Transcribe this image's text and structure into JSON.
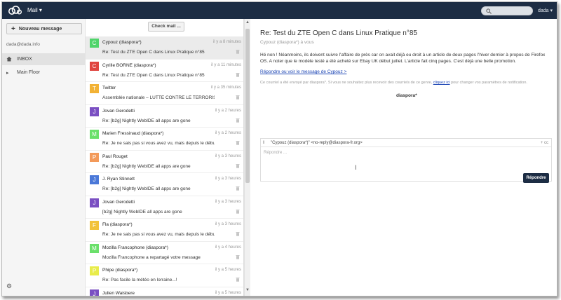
{
  "header": {
    "app_name": "Mail ▾",
    "user": "dada ▾",
    "search_placeholder": ""
  },
  "sidebar": {
    "new_message": "Nouveau message",
    "account": "dada@dada.info",
    "items": [
      {
        "label": "INBOX",
        "icon": "home-icon",
        "active": true
      },
      {
        "label": "Main Floor",
        "icon": "chevron-right-icon",
        "active": false
      }
    ]
  },
  "list": {
    "check_mail": "Check mail ...",
    "messages": [
      {
        "initial": "C",
        "color": "#4fd46a",
        "sender": "Cypouz (diaspora*)",
        "date": "il y a 8 minutes",
        "subject": "Re: Test du ZTE Open C dans Linux Pratique n°85",
        "selected": true
      },
      {
        "initial": "C",
        "color": "#e0443f",
        "sender": "Cyrille BORNE (diaspora*)",
        "date": "il y a 11 minutes",
        "subject": "Re: Test du ZTE Open C dans Linux Pratique n°85"
      },
      {
        "initial": "T",
        "color": "#f2b235",
        "sender": "Twitter",
        "date": "il y a 35 minutes",
        "subject": "Assemblée nationale – LUTTE CONTRE LE TERRORISME(..."
      },
      {
        "initial": "J",
        "color": "#7a4fc2",
        "sender": "Jovan Gerodetti",
        "date": "il y a 2 heures",
        "subject": "Re: [b2g] Nightly WebIDE all apps are gone"
      },
      {
        "initial": "M",
        "color": "#6be06b",
        "sender": "Marien Fressinaud (diaspora*)",
        "date": "il y a 2 heures",
        "subject": "Re: Je ne sais pas si vous avez vu, mais depuis le début d..."
      },
      {
        "initial": "P",
        "color": "#f39a5a",
        "sender": "Paul Rouget",
        "date": "il y a 3 heures",
        "subject": "Re: [b2g] Nightly WebIDE all apps are gone"
      },
      {
        "initial": "J",
        "color": "#4a78d8",
        "sender": "J. Ryan Stinnett",
        "date": "il y a 3 heures",
        "subject": "Re: [b2g] Nightly WebIDE all apps are gone"
      },
      {
        "initial": "J",
        "color": "#7a4fc2",
        "sender": "Jovan Gerodetti",
        "date": "il y a 3 heures",
        "subject": "[b2g] Nightly WebIDE all apps are gone"
      },
      {
        "initial": "F",
        "color": "#f2c23a",
        "sender": "Fla (diaspora*)",
        "date": "il y a 3 heures",
        "subject": "Re: Je ne sais pas si vous avez vu, mais depuis le début d..."
      },
      {
        "initial": "M",
        "color": "#6be06b",
        "sender": "Mozilla Francophone (diaspora*)",
        "date": "il y a 4 heures",
        "subject": "Mozilla Francophone a repartagé votre message"
      },
      {
        "initial": "P",
        "color": "#e8ec4a",
        "sender": "Phipe (diaspora*)",
        "date": "il y a 5 heures",
        "subject": "Re: Pas facile la météo en lorraine...!"
      },
      {
        "initial": "J",
        "color": "#7a4fc2",
        "sender": "Julien Waisbere",
        "date": "il y a 5 heures",
        "subject": ""
      }
    ]
  },
  "reader": {
    "subject": "Re: Test du ZTE Open C dans Linux Pratique n°85",
    "from": "Cypouz (diaspora*) à vous",
    "body": "Hé non ! Néanmoins, ils doivent suivre l'affaire de près car on avait déjà eu droit à un article de deux pages l'hiver dernier à propos de Firefox OS. A noter que le modèle testé a été acheté sur Ebay UK début juillet. L'article fait cinq pages. C'est déjà une belle promotion.",
    "reply_link": "Répondre ou voir le message de Cypouz >",
    "note_before": "Ce courriel a été envoyé par diaspora*. Si vous ne souhaitez plus recevoir des courriels de ce genre,",
    "note_link": "cliquez ici",
    "note_after": "pour changer vos paramètres de notification.",
    "signature": "diaspora*"
  },
  "composer": {
    "to": "\"Cypouz (diaspora*)\" <no-reply@diaspora-fr.org>",
    "cc": "+ cc",
    "placeholder": "Répondre ...",
    "send": "Répondre"
  }
}
